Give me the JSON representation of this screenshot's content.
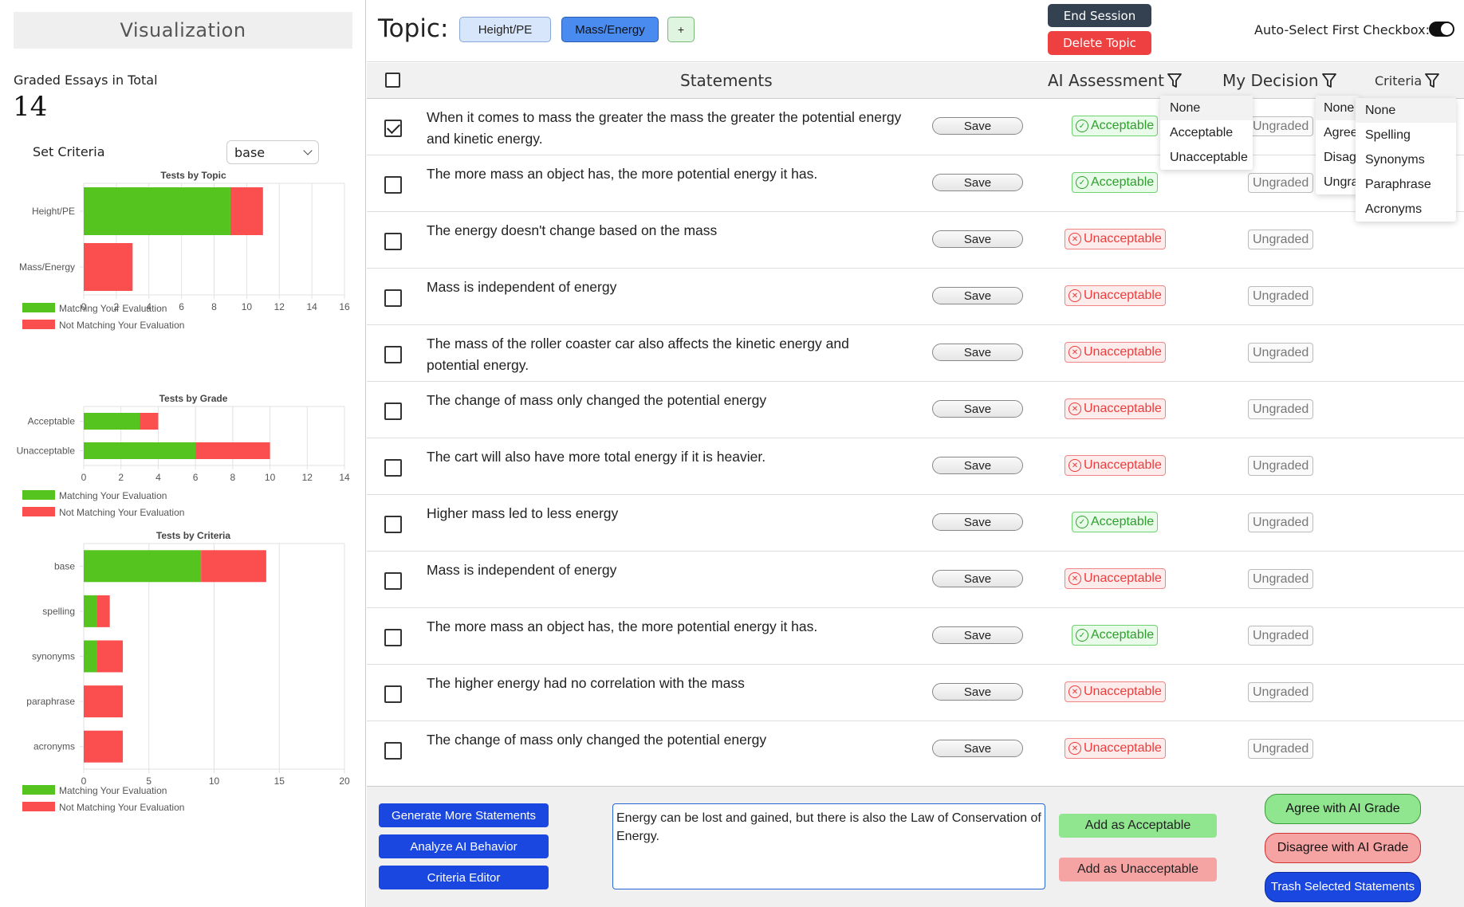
{
  "sidebar": {
    "title": "Visualization",
    "graded_label": "Graded Essays in Total",
    "graded_count": "14",
    "set_criteria_label": "Set Criteria",
    "criteria_value": "base"
  },
  "charts": {
    "legend_match": "Matching Your Evaluation",
    "legend_not_match": "Not Matching Your Evaluation",
    "colors": {
      "match": "#55c41f",
      "not_match": "#fb4f4f"
    }
  },
  "chart_data": [
    {
      "type": "bar",
      "orientation": "horizontal",
      "stacked": true,
      "title": "Tests by Topic",
      "categories": [
        "Height/PE",
        "Mass/Energy"
      ],
      "series": [
        {
          "name": "Matching Your Evaluation",
          "values": [
            9,
            0
          ]
        },
        {
          "name": "Not Matching Your Evaluation",
          "values": [
            2,
            3
          ]
        }
      ],
      "xlim": [
        0,
        16
      ],
      "xticks": [
        0,
        2,
        4,
        6,
        8,
        10,
        12,
        14,
        16
      ],
      "grid": true,
      "legend": "bottom-left"
    },
    {
      "type": "bar",
      "orientation": "horizontal",
      "stacked": true,
      "title": "Tests by Grade",
      "categories": [
        "Acceptable",
        "Unacceptable"
      ],
      "series": [
        {
          "name": "Matching Your Evaluation",
          "values": [
            3,
            6
          ]
        },
        {
          "name": "Not Matching Your Evaluation",
          "values": [
            1,
            4
          ]
        }
      ],
      "xlim": [
        0,
        14
      ],
      "xticks": [
        0,
        2,
        4,
        6,
        8,
        10,
        12,
        14
      ],
      "grid": true,
      "legend": "bottom-left"
    },
    {
      "type": "bar",
      "orientation": "horizontal",
      "stacked": true,
      "title": "Tests by Criteria",
      "categories": [
        "base",
        "spelling",
        "synonyms",
        "paraphrase",
        "acronyms"
      ],
      "series": [
        {
          "name": "Matching Your Evaluation",
          "values": [
            9,
            1,
            1,
            0,
            0
          ]
        },
        {
          "name": "Not Matching Your Evaluation",
          "values": [
            5,
            1,
            2,
            3,
            3
          ]
        }
      ],
      "xlim": [
        0,
        20
      ],
      "xticks": [
        0,
        5,
        10,
        15,
        20
      ],
      "grid": true,
      "legend": "bottom-left"
    }
  ],
  "header": {
    "topic_label": "Topic:",
    "topics": [
      "Height/PE",
      "Mass/Energy"
    ],
    "add_topic": "+",
    "end_session": "End Session",
    "delete_topic": "Delete Topic",
    "auto_select_label": "Auto-Select First Checkbox:",
    "auto_select_on": true
  },
  "table": {
    "col_statements": "Statements",
    "col_ai": "AI Assessment",
    "col_my": "My Decision",
    "col_criteria": "Criteria",
    "save_label": "Save",
    "ungraded_label": "Ungraded",
    "rows": [
      {
        "text": "When it comes to mass the greater the mass the greater the potential energy and kinetic energy.",
        "ai": "Acceptable",
        "checked": true
      },
      {
        "text": "The more mass an object has, the more potential energy it has.",
        "ai": "Acceptable",
        "checked": false
      },
      {
        "text": "The energy doesn't change based on the mass",
        "ai": "Unacceptable",
        "checked": false
      },
      {
        "text": "Mass is independent of energy",
        "ai": "Unacceptable",
        "checked": false
      },
      {
        "text": "The mass of the roller coaster car also affects the kinetic energy and potential energy.",
        "ai": "Unacceptable",
        "checked": false
      },
      {
        "text": "The change of mass only changed the potential energy",
        "ai": "Unacceptable",
        "checked": false
      },
      {
        "text": "The cart will also have more total energy if it is heavier.",
        "ai": "Unacceptable",
        "checked": false
      },
      {
        "text": "Higher mass led to less energy",
        "ai": "Acceptable",
        "checked": false
      },
      {
        "text": "Mass is independent of energy",
        "ai": "Unacceptable",
        "checked": false
      },
      {
        "text": "The more mass an object has, the more potential energy it has.",
        "ai": "Acceptable",
        "checked": false
      },
      {
        "text": "The higher energy had no correlation with the mass",
        "ai": "Unacceptable",
        "checked": false
      },
      {
        "text": "The change of mass only changed the potential energy",
        "ai": "Unacceptable",
        "checked": false
      }
    ]
  },
  "dropdowns": {
    "ai": [
      "None",
      "Acceptable",
      "Unacceptable"
    ],
    "my": [
      "None",
      "Agree",
      "Disagree",
      "Ungraded"
    ],
    "criteria": [
      "None",
      "Spelling",
      "Synonyms",
      "Paraphrase",
      "Acronyms"
    ]
  },
  "bottom": {
    "generate": "Generate More Statements",
    "analyze": "Analyze AI Behavior",
    "criteria_editor": "Criteria Editor",
    "new_statement": "Energy can be lost and gained, but there is also the Law of Conservation of Energy.",
    "add_acceptable": "Add as Acceptable",
    "add_unacceptable": "Add as Unacceptable",
    "agree": "Agree with AI Grade",
    "disagree": "Disagree with AI Grade",
    "trash": "Trash Selected Statements"
  }
}
